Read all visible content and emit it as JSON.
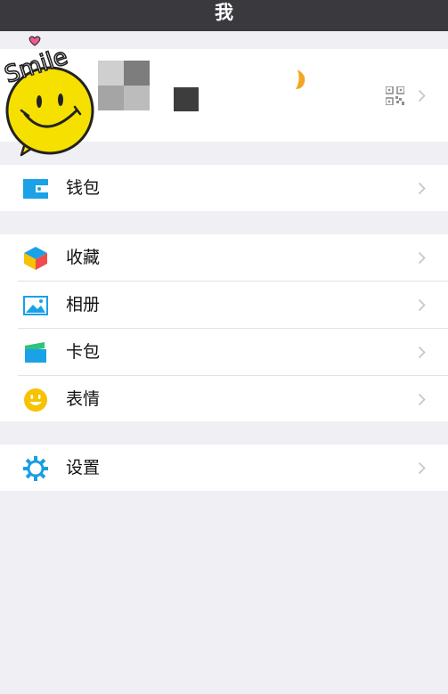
{
  "nav": {
    "title": "我"
  },
  "profile": {
    "sticker_text": "Smile"
  },
  "sections": {
    "wallet": {
      "label": "钱包",
      "icon": "wallet-icon"
    },
    "favorites": {
      "label": "收藏",
      "icon": "favorites-cube-icon"
    },
    "album": {
      "label": "相册",
      "icon": "photo-album-icon"
    },
    "card_package": {
      "label": "卡包",
      "icon": "card-package-icon"
    },
    "stickers": {
      "label": "表情",
      "icon": "smiley-icon"
    },
    "settings": {
      "label": "设置",
      "icon": "gear-icon"
    }
  },
  "colors": {
    "nav_bg": "#3a393e",
    "page_bg": "#efeff4",
    "wallet_blue": "#1aa1e7",
    "smiley_yellow": "#f7c200",
    "settings_blue": "#1a9ee3"
  }
}
